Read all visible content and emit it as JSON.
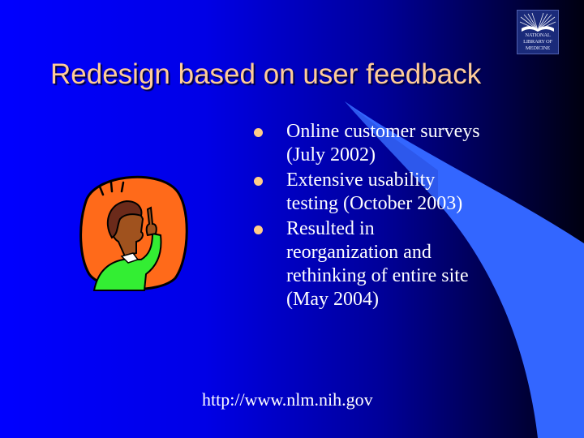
{
  "slide": {
    "title": "Redesign based on user feedback",
    "logo": {
      "icon": "national-library-of-medicine-logo",
      "text": "NATIONAL\nLIBRARY OF\nMEDICINE"
    },
    "bullets": [
      {
        "text": "Online customer surveys (July 2002)"
      },
      {
        "text": "Extensive usability testing (October 2003)"
      },
      {
        "text": "Resulted in reorganization and rethinking of entire site (May 2004)"
      }
    ],
    "url": "http://www.nlm.nih.gov",
    "clipart": "person-with-idea-clipart",
    "colors": {
      "title": "#ffcc99",
      "bullet": "#ffcc88",
      "text": "#ffffff",
      "swoosh": "#3366ff"
    }
  }
}
